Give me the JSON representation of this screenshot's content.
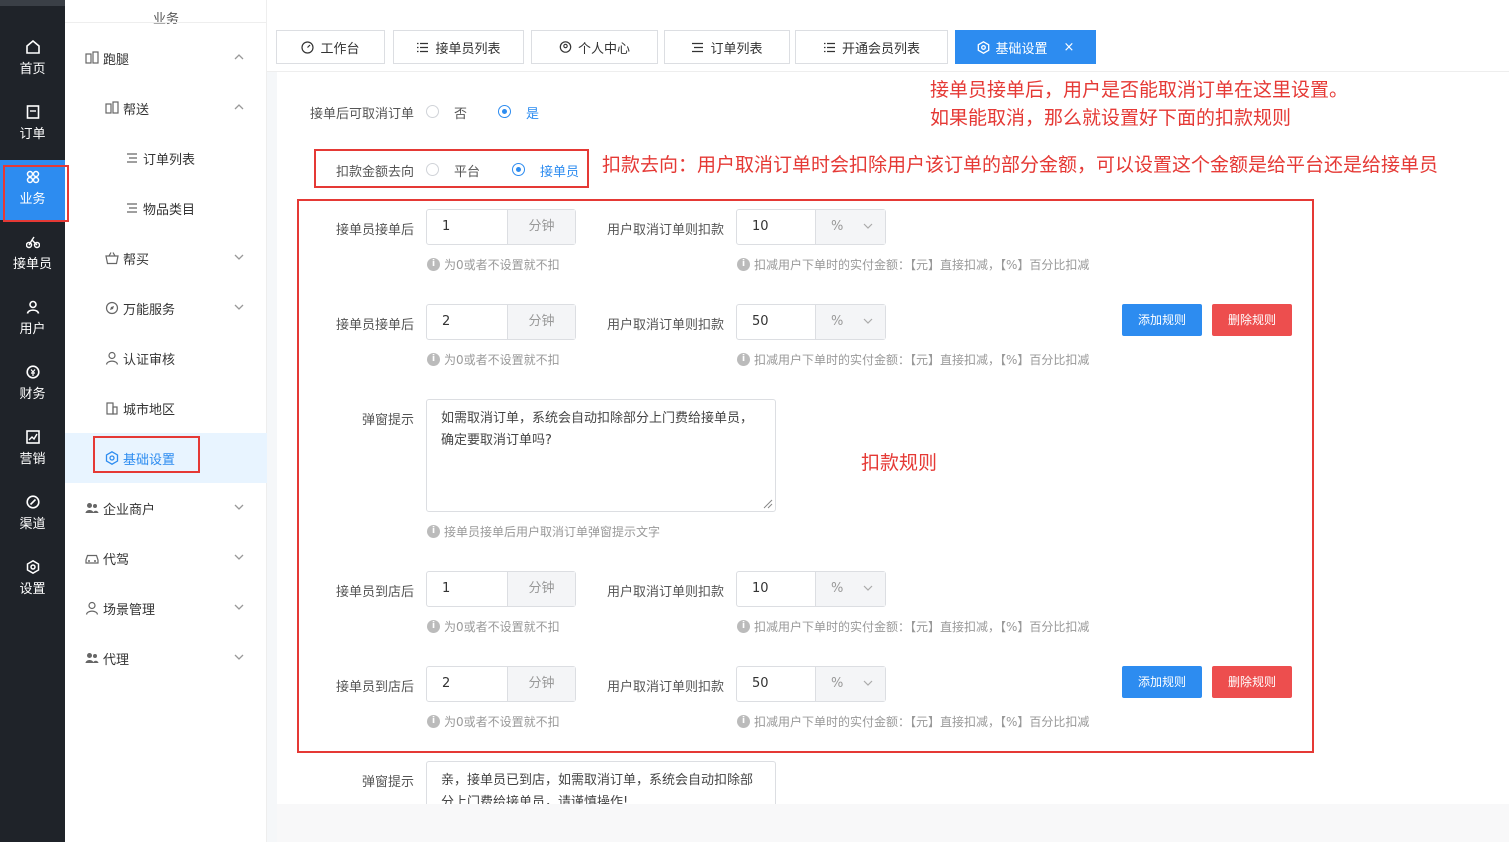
{
  "rail": {
    "items": [
      {
        "label": "首页",
        "icon": "home-icon"
      },
      {
        "label": "订单",
        "icon": "order-icon"
      },
      {
        "label": "业务",
        "icon": "business-icon",
        "active": true
      },
      {
        "label": "接单员",
        "icon": "bike-icon"
      },
      {
        "label": "用户",
        "icon": "user-icon"
      },
      {
        "label": "财务",
        "icon": "finance-icon"
      },
      {
        "label": "营销",
        "icon": "chart-icon"
      },
      {
        "label": "渠道",
        "icon": "channel-icon"
      },
      {
        "label": "设置",
        "icon": "settings-icon"
      }
    ]
  },
  "submenu": {
    "title": "业务",
    "items": [
      {
        "label": "跑腿"
      },
      {
        "label": "帮送"
      },
      {
        "label": "订单列表"
      },
      {
        "label": "物品类目"
      },
      {
        "label": "帮买"
      },
      {
        "label": "万能服务"
      },
      {
        "label": "认证审核"
      },
      {
        "label": "城市地区"
      },
      {
        "label": "基础设置"
      },
      {
        "label": "企业商户"
      },
      {
        "label": "代驾"
      },
      {
        "label": "场景管理"
      },
      {
        "label": "代理"
      }
    ]
  },
  "tabs": [
    {
      "label": "工作台"
    },
    {
      "label": "接单员列表"
    },
    {
      "label": "个人中心"
    },
    {
      "label": "订单列表"
    },
    {
      "label": "开通会员列表"
    },
    {
      "label": "基础设置",
      "close": "×"
    }
  ],
  "form": {
    "cancel_label": "接单后可取消订单",
    "cancel_no": "否",
    "cancel_yes": "是",
    "direction_label": "扣款金额去向",
    "direction_platform": "平台",
    "direction_rider": "接单员",
    "rules_after_accept": [
      {
        "label": "接单员接单后",
        "minutes": "1",
        "unit": "分钟",
        "deduct_label": "用户取消订单则扣款",
        "deduct": "10",
        "deduct_unit": "%"
      },
      {
        "label": "接单员接单后",
        "minutes": "2",
        "unit": "分钟",
        "deduct_label": "用户取消订单则扣款",
        "deduct": "50",
        "deduct_unit": "%"
      }
    ],
    "rules_after_arrive": [
      {
        "label": "接单员到店后",
        "minutes": "1",
        "unit": "分钟",
        "deduct_label": "用户取消订单则扣款",
        "deduct": "10",
        "deduct_unit": "%"
      },
      {
        "label": "接单员到店后",
        "minutes": "2",
        "unit": "分钟",
        "deduct_label": "用户取消订单则扣款",
        "deduct": "50",
        "deduct_unit": "%"
      }
    ],
    "hint_minutes": "为0或者不设置就不扣",
    "hint_deduct": "扣减用户下单时的实付金额：【元】直接扣减，【%】百分比扣减",
    "add_rule": "添加规则",
    "delete_rule": "删除规则",
    "popup_label": "弹窗提示",
    "popup_text_1": "如需取消订单，系统会自动扣除部分上门费给接单员，确定要取消订单吗?",
    "popup_hint_1": "接单员接单后用户取消订单弹窗提示文字",
    "popup_text_2": "亲，接单员已到店，如需取消订单，系统会自动扣除部分上门费给接单员，请谨慎操作!"
  },
  "annotations": {
    "cancel_note_1": "接单员接单后，用户是否能取消订单在这里设置。",
    "cancel_note_2": "如果能取消，那么就设置好下面的扣款规则",
    "direction_note": "扣款去向：用户取消订单时会扣除用户该订单的部分金额，可以设置这个金额是给平台还是给接单员",
    "rules_note": "扣款规则",
    "color": "#e53935"
  }
}
